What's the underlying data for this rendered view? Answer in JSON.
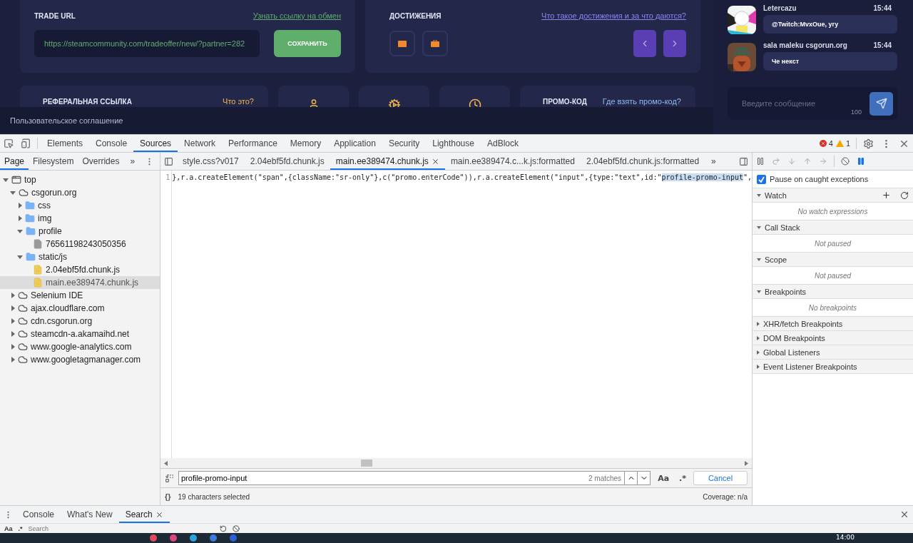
{
  "site": {
    "trade_url": {
      "title": "TRADE URL",
      "link": "Узнать ссылку на обмен",
      "value": "https://steamcommunity.com/tradeoffer/new/?partner=282",
      "button": "СОХРАНИТЬ"
    },
    "achievements": {
      "title": "ДОСТИЖЕНИЯ",
      "link": "Что такое достижения и за что даются?"
    },
    "referral": {
      "title": "РЕФЕРАЛЬНАЯ ССЫЛКА",
      "link": "Что это?"
    },
    "promo": {
      "title": "ПРОМО-КОД",
      "link": "Где взять промо-код?"
    },
    "footer_link": "Пользовательское соглашение"
  },
  "chat": {
    "messages": [
      {
        "name": "Letercazu",
        "time": "15:44",
        "text": "@Twitch:MvxOue, угу"
      },
      {
        "name": "sala maleku csgorun.org",
        "time": "15:44",
        "text": "Че некст"
      }
    ],
    "input": {
      "placeholder": "Введите сообщение",
      "counter": "100"
    }
  },
  "devtools": {
    "main_tabs": [
      {
        "label": "Elements",
        "selected": false
      },
      {
        "label": "Console",
        "selected": false
      },
      {
        "label": "Sources",
        "selected": true
      },
      {
        "label": "Network",
        "selected": false
      },
      {
        "label": "Performance",
        "selected": false
      },
      {
        "label": "Memory",
        "selected": false
      },
      {
        "label": "Application",
        "selected": false
      },
      {
        "label": "Security",
        "selected": false
      },
      {
        "label": "Lighthouse",
        "selected": false
      },
      {
        "label": "AdBlock",
        "selected": false
      }
    ],
    "errors": "4",
    "warnings": "1",
    "navigator_tabs": [
      {
        "label": "Page",
        "selected": true
      },
      {
        "label": "Filesystem",
        "selected": false
      },
      {
        "label": "Overrides",
        "selected": false
      }
    ],
    "more_tabs": "»",
    "editor_tabs": [
      {
        "label": "style.css?v017",
        "selected": false,
        "closable": false
      },
      {
        "label": "2.04ebf5fd.chunk.js",
        "selected": false,
        "closable": false
      },
      {
        "label": "main.ee389474.chunk.js",
        "selected": true,
        "closable": true
      },
      {
        "label": "main.ee389474.c...k.js:formatted",
        "selected": false,
        "closable": false
      },
      {
        "label": "2.04ebf5fd.chunk.js:formatted",
        "selected": false,
        "closable": false
      }
    ],
    "tree": [
      {
        "label": "top",
        "kind": "frame",
        "expanded": true,
        "selected": false,
        "children": [
          {
            "label": "csgorun.org",
            "kind": "domain",
            "expanded": true,
            "selected": false,
            "children": [
              {
                "label": "css",
                "kind": "folder",
                "expanded": false,
                "selected": false
              },
              {
                "label": "img",
                "kind": "folder",
                "expanded": false,
                "selected": false
              },
              {
                "label": "profile",
                "kind": "folder",
                "expanded": true,
                "selected": false,
                "children": [
                  {
                    "label": "76561198243050356",
                    "kind": "document",
                    "selected": false
                  }
                ]
              },
              {
                "label": "static/js",
                "kind": "folder",
                "expanded": true,
                "selected": false,
                "children": [
                  {
                    "label": "2.04ebf5fd.chunk.js",
                    "kind": "script",
                    "selected": false
                  },
                  {
                    "label": "main.ee389474.chunk.js",
                    "kind": "script",
                    "selected": true
                  }
                ]
              }
            ]
          },
          {
            "label": "Selenium IDE",
            "kind": "domain",
            "expanded": false,
            "selected": false
          },
          {
            "label": "ajax.cloudflare.com",
            "kind": "domain",
            "expanded": false,
            "selected": false
          },
          {
            "label": "cdn.csgorun.org",
            "kind": "domain",
            "expanded": false,
            "selected": false
          },
          {
            "label": "steamcdn-a.akamaihd.net",
            "kind": "domain",
            "expanded": false,
            "selected": false
          },
          {
            "label": "www.google-analytics.com",
            "kind": "domain",
            "expanded": false,
            "selected": false
          },
          {
            "label": "www.googletagmanager.com",
            "kind": "domain",
            "expanded": false,
            "selected": false
          }
        ]
      }
    ],
    "code_line": {
      "number": "1",
      "segments": [
        {
          "text": "},r.a.createElement(\"span\",{className:\"sr-only\"},c(\"promo.enterCode\")),r.a.createElement(\"input\",{type:\"text\",id:\"",
          "highlighted": false
        },
        {
          "text": "profile-promo-input",
          "highlighted": true
        },
        {
          "text": "\",",
          "highlighted": false
        }
      ]
    },
    "pause_on_caught": {
      "label": "Pause on caught exceptions",
      "checked": true
    },
    "sections": [
      {
        "title": "Watch",
        "expanded": true,
        "empty_text": "No watch expressions",
        "kind": "watch"
      },
      {
        "title": "Call Stack",
        "expanded": true,
        "empty_text": "Not paused",
        "kind": "plain"
      },
      {
        "title": "Scope",
        "expanded": true,
        "empty_text": "Not paused",
        "kind": "plain"
      },
      {
        "title": "Breakpoints",
        "expanded": true,
        "empty_text": "No breakpoints",
        "kind": "plain"
      },
      {
        "title": "XHR/fetch Breakpoints",
        "expanded": false,
        "kind": "plain"
      },
      {
        "title": "DOM Breakpoints",
        "expanded": false,
        "kind": "plain"
      },
      {
        "title": "Global Listeners",
        "expanded": false,
        "kind": "plain"
      },
      {
        "title": "Event Listener Breakpoints",
        "expanded": false,
        "kind": "plain"
      }
    ],
    "search": {
      "value": "profile-promo-input",
      "matches": "2 matches",
      "case_label": "Aa",
      "regex_label": ".*",
      "cancel": "Cancel"
    },
    "status": {
      "format_label": "{}",
      "selection": "19 characters selected",
      "coverage": "Coverage: n/a"
    },
    "drawer_tabs": [
      {
        "label": "Console",
        "selected": false,
        "closable": false
      },
      {
        "label": "What's New",
        "selected": false,
        "closable": false
      },
      {
        "label": "Search",
        "selected": true,
        "closable": true
      }
    ],
    "drawer_search": {
      "case_label": "Aa",
      "regex_label": ".*",
      "placeholder": "Search"
    }
  },
  "taskbar": {
    "time": "14:00"
  }
}
